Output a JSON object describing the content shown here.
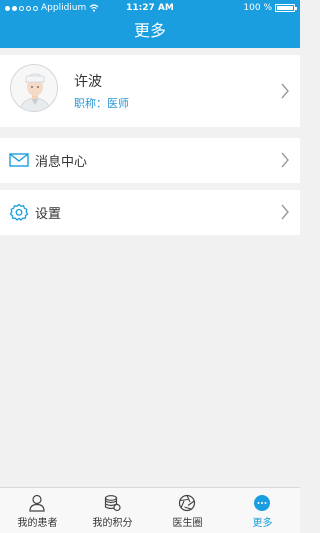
{
  "status_bar": {
    "carrier": "Applidium",
    "time": "11:27 AM",
    "battery": "100 %"
  },
  "header": {
    "title": "更多"
  },
  "profile": {
    "name": "许波",
    "job_title": "职称：医师"
  },
  "menu": [
    {
      "label": "消息中心",
      "icon": "envelope-icon"
    },
    {
      "label": "设置",
      "icon": "gear-icon"
    }
  ],
  "tabbar": {
    "tabs": [
      {
        "label": "我的患者",
        "icon": "person-icon"
      },
      {
        "label": "我的积分",
        "icon": "coins-icon"
      },
      {
        "label": "医生圈",
        "icon": "aperture-icon"
      },
      {
        "label": "更多",
        "icon": "more-icon"
      }
    ],
    "active_index": 3
  },
  "colors": {
    "accent": "#1a9ee0",
    "link_text": "#2a97d4",
    "background": "#f1f1f1"
  }
}
